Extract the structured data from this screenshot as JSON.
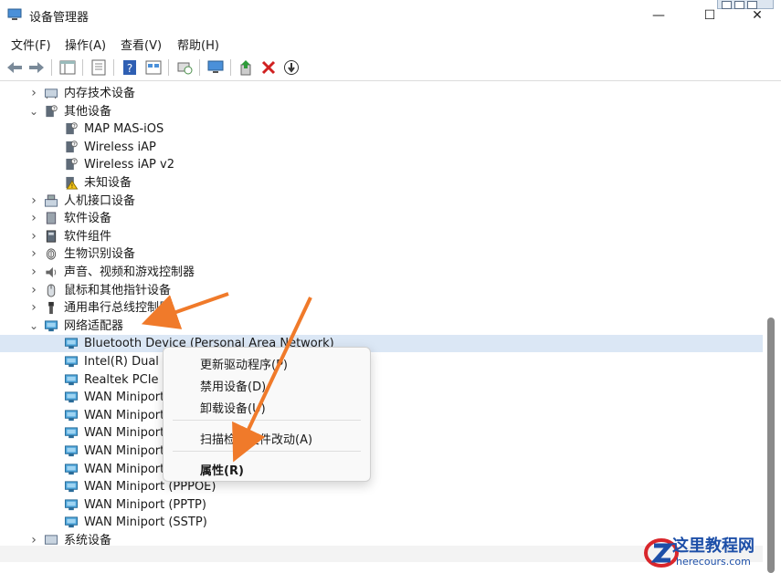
{
  "window": {
    "title": "设备管理器",
    "minimize": "—",
    "maximize": "☐",
    "close": "✕"
  },
  "menu": [
    "文件(F)",
    "操作(A)",
    "查看(V)",
    "帮助(H)"
  ],
  "tree": [
    {
      "label": "内存技术设备",
      "icon": "memory-icon",
      "expander": "collapsed"
    },
    {
      "label": "其他设备",
      "icon": "other-devices-icon",
      "expander": "expanded"
    },
    {
      "label": "MAP MAS-iOS",
      "icon": "unknown-device-icon"
    },
    {
      "label": "Wireless iAP",
      "icon": "unknown-device-icon"
    },
    {
      "label": "Wireless iAP v2",
      "icon": "unknown-device-icon"
    },
    {
      "label": "未知设备",
      "icon": "warning-device-icon"
    },
    {
      "label": "人机接口设备",
      "icon": "hid-icon",
      "expander": "collapsed"
    },
    {
      "label": "软件设备",
      "icon": "software-device-icon",
      "expander": "collapsed"
    },
    {
      "label": "软件组件",
      "icon": "software-component-icon",
      "expander": "collapsed"
    },
    {
      "label": "生物识别设备",
      "icon": "biometric-icon",
      "expander": "collapsed"
    },
    {
      "label": "声音、视频和游戏控制器",
      "icon": "audio-icon",
      "expander": "collapsed"
    },
    {
      "label": "鼠标和其他指针设备",
      "icon": "mouse-icon",
      "expander": "collapsed"
    },
    {
      "label": "通用串行总线控制器",
      "icon": "usb-icon",
      "expander": "collapsed"
    },
    {
      "label": "网络适配器",
      "icon": "network-adapter-icon",
      "expander": "expanded"
    },
    {
      "label": "Bluetooth Device (Personal Area Network)",
      "icon": "network-adapter-icon",
      "selected": true
    },
    {
      "label": "Intel(R) Dual B",
      "icon": "network-adapter-icon"
    },
    {
      "label": "Realtek PCIe G",
      "icon": "network-adapter-icon"
    },
    {
      "label": "WAN Miniport",
      "icon": "network-adapter-icon"
    },
    {
      "label": "WAN Miniport",
      "icon": "network-adapter-icon"
    },
    {
      "label": "WAN Miniport",
      "icon": "network-adapter-icon"
    },
    {
      "label": "WAN Miniport",
      "icon": "network-adapter-icon"
    },
    {
      "label": "WAN Miniport",
      "icon": "network-adapter-icon"
    },
    {
      "label": "WAN Miniport (PPPOE)",
      "icon": "network-adapter-icon"
    },
    {
      "label": "WAN Miniport (PPTP)",
      "icon": "network-adapter-icon"
    },
    {
      "label": "WAN Miniport (SSTP)",
      "icon": "network-adapter-icon"
    },
    {
      "label": "系统设备",
      "icon": "system-device-icon",
      "expander": "collapsed"
    }
  ],
  "context_menu": {
    "update_driver": "更新驱动程序(P)",
    "disable_device": "禁用设备(D)",
    "uninstall_device": "卸载设备(U)",
    "scan_hardware": "扫描检测硬件改动(A)",
    "properties": "属性(R)"
  },
  "watermark": {
    "title": "这里教程网",
    "url": "herecours.com"
  },
  "colors": {
    "accent_arrow": "#f07a2a",
    "selection": "#dbe7f5",
    "watermark_blue": "#1d4fa8",
    "watermark_red": "#d9262b"
  }
}
